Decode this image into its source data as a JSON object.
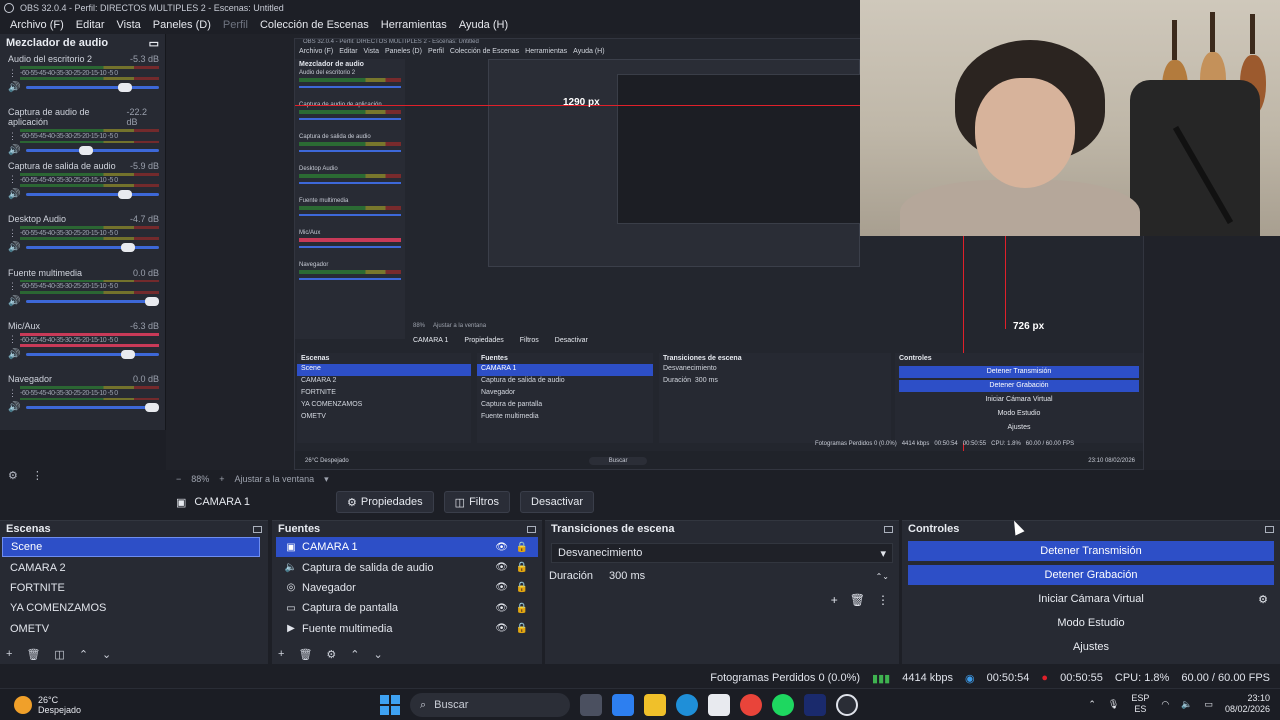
{
  "window": {
    "title": "OBS 32.0.4 - Perfil: DIRECTOS MULTIPLES 2 - Escenas: Untitled"
  },
  "menu": [
    "Archivo (F)",
    "Editar",
    "Vista",
    "Paneles (D)",
    "Perfil",
    "Colección de Escenas",
    "Herramientas",
    "Ayuda (H)"
  ],
  "mixer": {
    "title": "Mezclador de audio",
    "ticks": "-60-55-45-40-35-30-25-20-15-10 -5 0",
    "channels": [
      {
        "name": "Audio del escritorio 2",
        "db": "-5.3 dB",
        "level": 0.8
      },
      {
        "name": "Captura de audio de aplicación",
        "db": "-22.2 dB",
        "level": 0.5
      },
      {
        "name": "Captura de salida de audio",
        "db": "-5.9 dB",
        "level": 0.8
      },
      {
        "name": "Desktop Audio",
        "db": "-4.7 dB",
        "level": 0.82
      },
      {
        "name": "Fuente multimedia",
        "db": "0.0 dB",
        "level": 1.0
      },
      {
        "name": "Mic/Aux",
        "db": "-6.3 dB",
        "level": 0.82,
        "muted": true
      },
      {
        "name": "Navegador",
        "db": "0.0 dB",
        "level": 1.0
      }
    ]
  },
  "nested": {
    "title": "OBS 32.0.4 - Perfil: DIRECTOS MULTIPLES 2 - Escenas: Untitled",
    "menu": [
      "Archivo (F)",
      "Editar",
      "Vista",
      "Paneles (D)",
      "Perfil",
      "Colección de Escenas",
      "Herramientas",
      "Ayuda (H)"
    ],
    "mixer_title": "Mezclador de audio",
    "channels": [
      "Audio del escritorio 2",
      "Captura de audio de aplicación",
      "Captura de salida de audio",
      "Desktop Audio",
      "Fuente multimedia",
      "Mic/Aux",
      "Navegador"
    ],
    "width_label": "1290 px",
    "height_label": "726 px",
    "source_name": "CAMARA 1",
    "props_label": "Propiedades",
    "filters_label": "Filtros",
    "deactivate_label": "Desactivar",
    "scenes_title": "Escenas",
    "sources_title": "Fuentes",
    "transitions_title": "Transiciones de escena",
    "controls_title": "Controles",
    "scenes": [
      "Scene",
      "CAMARA 2",
      "FORTNITE",
      "YA COMENZAMOS",
      "OMETV"
    ],
    "sources": [
      "CAMARA 1",
      "Captura de salida de audio",
      "Navegador",
      "Captura de pantalla",
      "Fuente multimedia"
    ],
    "transition": "Desvanecimiento",
    "duration_label": "Duración",
    "duration": "300 ms",
    "controls": [
      "Detener Transmisión",
      "Detener Grabación",
      "Iniciar Cámara Virtual",
      "Modo Estudio",
      "Ajustes"
    ],
    "zoom": "88%",
    "fit_label": "Ajustar a la ventana",
    "status": "Fotogramas Perdidos 0 (0.0%)   4414 kbps   00:50:54   00:50:55   CPU: 1.8%   60.00 / 60.00 FPS",
    "weather": "26°C Despejado",
    "search": "Buscar",
    "clock": "23:10 08/02/2026"
  },
  "transform": {
    "zoom": "88%",
    "fit": "Ajustar a la ventana"
  },
  "sourcebar": {
    "camera": "CAMARA 1",
    "properties": "Propiedades",
    "filters": "Filtros",
    "deactivate": "Desactivar"
  },
  "scenes": {
    "title": "Escenas",
    "items": [
      "Scene",
      "CAMARA 2",
      "FORTNITE",
      "YA COMENZAMOS",
      "OMETV"
    ],
    "selected": 0
  },
  "sources": {
    "title": "Fuentes",
    "items": [
      {
        "name": "CAMARA 1",
        "icon": "camera-icon"
      },
      {
        "name": "Captura de salida de audio",
        "icon": "speaker-icon"
      },
      {
        "name": "Navegador",
        "icon": "globe-icon"
      },
      {
        "name": "Captura de pantalla",
        "icon": "monitor-icon"
      },
      {
        "name": "Fuente multimedia",
        "icon": "play-icon"
      }
    ],
    "selected": 0
  },
  "transitions": {
    "title": "Transiciones de escena",
    "selected": "Desvanecimiento",
    "duration_label": "Duración",
    "duration": "300 ms"
  },
  "controls": {
    "title": "Controles",
    "buttons": [
      {
        "label": "Detener Transmisión",
        "active": true
      },
      {
        "label": "Detener Grabación",
        "active": true
      },
      {
        "label": "Iniciar Cámara Virtual",
        "active": false
      },
      {
        "label": "Modo Estudio",
        "active": false
      },
      {
        "label": "Ajustes",
        "active": false
      }
    ]
  },
  "status": {
    "dropped": "Fotogramas Perdidos 0 (0.0%)",
    "bitrate": "4414 kbps",
    "stream_time": "00:50:54",
    "rec_time": "00:50:55",
    "cpu": "CPU: 1.8%",
    "fps": "60.00 / 60.00 FPS"
  },
  "taskbar": {
    "temp": "26°C",
    "weather": "Despejado",
    "search": "Buscar",
    "lang_top": "ESP",
    "lang_bottom": "ES",
    "time": "23:10",
    "date": "08/02/2026"
  },
  "colors": {
    "accent": "#2d4fc7",
    "record": "#e0202a",
    "signal": "#3fb350"
  }
}
